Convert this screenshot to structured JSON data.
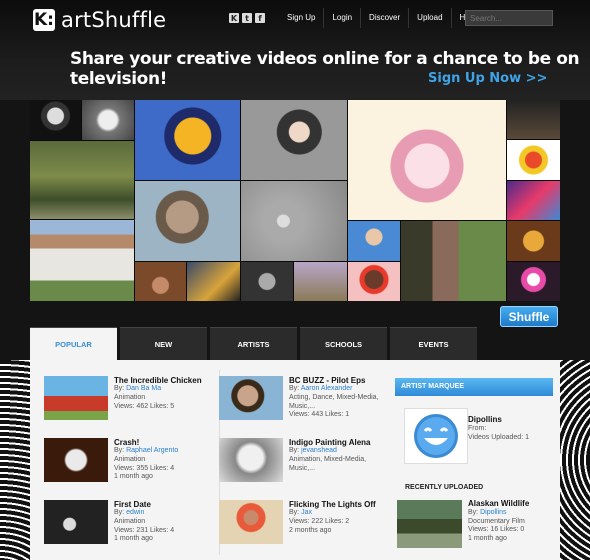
{
  "header": {
    "logo_mark": "K:",
    "logo_text": "artShuffle",
    "social": [
      "K",
      "t",
      "f"
    ],
    "nav": [
      "Sign Up",
      "Login",
      "Discover",
      "Upload",
      "Help"
    ],
    "search_placeholder": "Search...",
    "tagline": "Share your creative videos online for a chance to be on television!",
    "signup_cta": "Sign Up Now >>"
  },
  "shuffle_label": "Shuffle",
  "tabs": [
    "POPULAR",
    "NEW",
    "ARTISTS",
    "SCHOOLS",
    "EVENTS"
  ],
  "col1": [
    {
      "title": "The Incredible Chicken",
      "by_label": "By:",
      "by": "Dan Ba Ma",
      "category": "Animation",
      "stats": "Views: 462 Likes: 5",
      "date": ""
    },
    {
      "title": "Crash!",
      "by_label": "By:",
      "by": "Raphael Argento",
      "category": "Animation",
      "stats": "Views: 355 Likes: 4",
      "date": "1 month ago"
    },
    {
      "title": "First Date",
      "by_label": "By:",
      "by": "edwin",
      "category": "Animation",
      "stats": "Views: 231 Likes: 4",
      "date": "1 month ago"
    }
  ],
  "col2": [
    {
      "title": "BC BUZZ - Pilot Eps",
      "by_label": "By:",
      "by": "Aaron Alexander",
      "category": "Acting, Dance, Mixed-Media, Music,...",
      "stats": "Views: 443 Likes: 1",
      "date": ""
    },
    {
      "title": "Indigo Painting Alena",
      "by_label": "By:",
      "by": "jevanshead",
      "category": "Animation, Mixed-Media, Music,...",
      "stats": "",
      "date": ""
    },
    {
      "title": "Flicking The Lights Off",
      "by_label": "By:",
      "by": "Jax",
      "category": "",
      "stats": "Views: 222 Likes: 2",
      "date": "2 months ago"
    }
  ],
  "marquee": {
    "heading": "ARTIST MARQUEE",
    "name": "Dipollins",
    "from": "From:",
    "uploaded": "Videos Uploaded: 1"
  },
  "recent": {
    "heading": "RECENTLY UPLOADED",
    "title": "Alaskan Wildlife",
    "by_label": "By:",
    "by": "Dipollins",
    "category": "Documentary Film",
    "stats": "Views: 16 Likes: 0",
    "date": "1 month ago"
  }
}
